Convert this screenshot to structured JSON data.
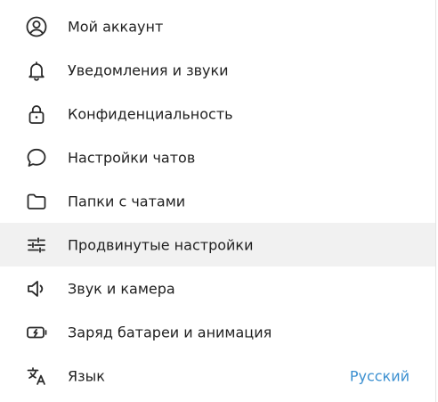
{
  "colors": {
    "text": "#1f1f1f",
    "icon": "#2b2b2b",
    "accent": "#3a8fd0",
    "active_bg": "#f1f1f1"
  },
  "menu": {
    "items": [
      {
        "label": "Мой аккаунт",
        "icon": "account-icon"
      },
      {
        "label": "Уведомления и звуки",
        "icon": "bell-icon"
      },
      {
        "label": "Конфиденциальность",
        "icon": "lock-icon"
      },
      {
        "label": "Настройки чатов",
        "icon": "chat-bubble-icon"
      },
      {
        "label": "Папки с чатами",
        "icon": "folder-icon"
      },
      {
        "label": "Продвинутые настройки",
        "icon": "sliders-icon",
        "active": true
      },
      {
        "label": "Звук и камера",
        "icon": "speaker-icon"
      },
      {
        "label": "Заряд батареи и анимация",
        "icon": "battery-icon"
      },
      {
        "label": "Язык",
        "icon": "translate-icon",
        "value": "Русский"
      }
    ]
  }
}
